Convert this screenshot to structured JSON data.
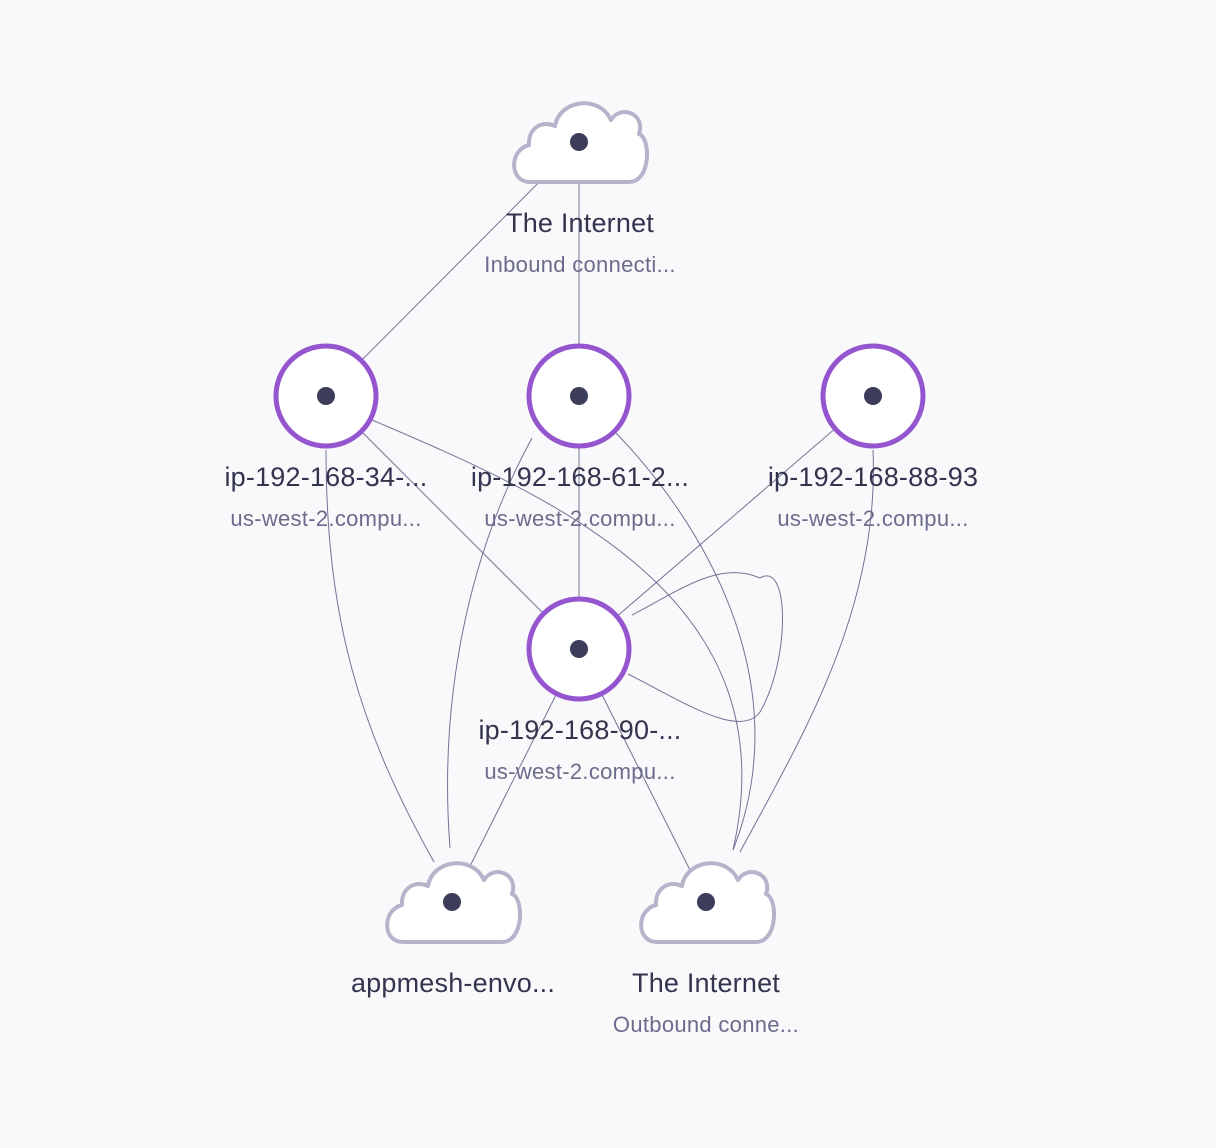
{
  "colors": {
    "background": "#f9f9fb",
    "host_ring": "#9455cf",
    "cloud_outline": "#b6b3cb",
    "center_dot": "#3c3d5a",
    "edge": "#5d5a85"
  },
  "nodes": [
    {
      "id": "internet-in",
      "kind": "cloud",
      "icon": "cloud-icon",
      "title": "The Internet",
      "subtitle": "Inbound connecti..."
    },
    {
      "id": "host-34",
      "kind": "host",
      "icon": "host-ring-icon",
      "title": "ip-192-168-34-...",
      "subtitle": "us-west-2.compu..."
    },
    {
      "id": "host-61",
      "kind": "host",
      "icon": "host-ring-icon",
      "title": "ip-192-168-61-2...",
      "subtitle": "us-west-2.compu..."
    },
    {
      "id": "host-88",
      "kind": "host",
      "icon": "host-ring-icon",
      "title": "ip-192-168-88-93",
      "subtitle": "us-west-2.compu..."
    },
    {
      "id": "host-90",
      "kind": "host",
      "icon": "host-ring-icon",
      "title": "ip-192-168-90-...",
      "subtitle": "us-west-2.compu..."
    },
    {
      "id": "appmesh",
      "kind": "cloud",
      "icon": "cloud-icon",
      "title": "appmesh-envo...",
      "subtitle": ""
    },
    {
      "id": "internet-out",
      "kind": "cloud",
      "icon": "cloud-icon",
      "title": "The Internet",
      "subtitle": "Outbound conne..."
    }
  ],
  "edges": [
    {
      "from": "internet-in",
      "to": "host-34"
    },
    {
      "from": "internet-in",
      "to": "host-61"
    },
    {
      "from": "host-34",
      "to": "host-90"
    },
    {
      "from": "host-34",
      "to": "appmesh"
    },
    {
      "from": "host-34",
      "to": "internet-out"
    },
    {
      "from": "host-61",
      "to": "host-90"
    },
    {
      "from": "host-61",
      "to": "appmesh"
    },
    {
      "from": "host-61",
      "to": "internet-out"
    },
    {
      "from": "host-88",
      "to": "host-90"
    },
    {
      "from": "host-88",
      "to": "internet-out"
    },
    {
      "from": "host-90",
      "to": "appmesh"
    },
    {
      "from": "host-90",
      "to": "internet-out"
    },
    {
      "from": "host-90",
      "to": "host-90"
    }
  ]
}
